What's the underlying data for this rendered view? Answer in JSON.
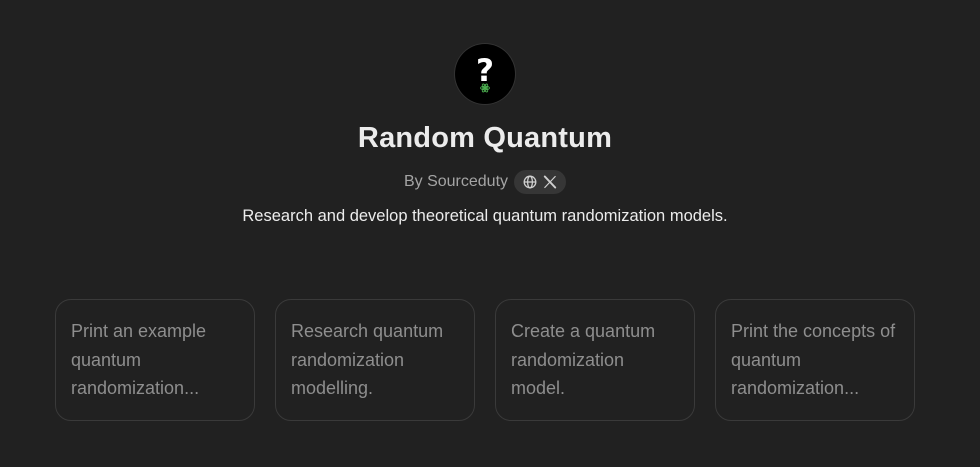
{
  "gpt": {
    "title": "Random Quantum",
    "byline": "By Sourceduty",
    "description": "Research and develop theoretical quantum randomization models."
  },
  "avatar": {
    "icon": "question-mark-icon",
    "glyph": "?"
  },
  "social_links": [
    {
      "icon": "globe-icon"
    },
    {
      "icon": "x-logo-icon"
    }
  ],
  "conversation_starters": [
    {
      "text": "Print an example quantum randomization..."
    },
    {
      "text": "Research quantum randomization modelling."
    },
    {
      "text": "Create a quantum randomization model."
    },
    {
      "text": "Print the concepts of quantum randomization..."
    }
  ],
  "colors": {
    "background": "#212121",
    "title": "#ececec",
    "muted": "#a4a4a4",
    "card_text": "#8e8e8e",
    "card_border": "#3a3a3a",
    "pill": "#363636",
    "atom_accent": "#4caf50"
  }
}
